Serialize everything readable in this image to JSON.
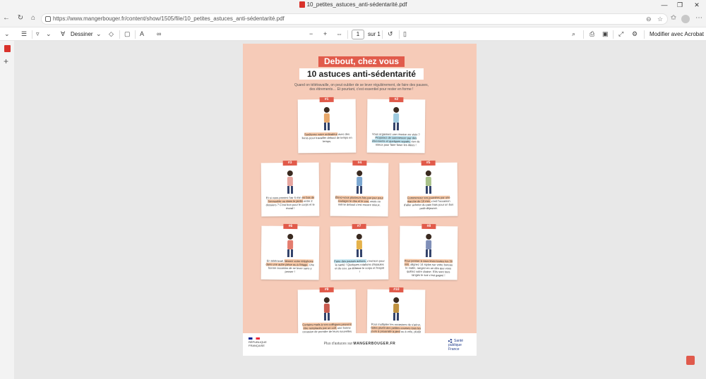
{
  "window": {
    "title": "10_petites_astuces_anti-sédentarité.pdf",
    "min": "—",
    "max": "❐",
    "close": "✕"
  },
  "address": {
    "url": "https://www.mangerbouger.fr/content/show/1505/file/10_petites_astuces_anti-sédentarité.pdf"
  },
  "pdf_toolbar": {
    "draw_label": "Dessiner",
    "page_current": "1",
    "page_total": "sur 1",
    "zoom_out": "−",
    "zoom_in": "+",
    "open_acrobat": "Modifier avec Acrobat"
  },
  "poster": {
    "title1": "Debout, chez vous",
    "title2": "10 astuces anti-sédentarité",
    "intro": "Quand on télétravaille, on peut oublier de se lever régulièrement, de faire des pauses, des étirements… Et pourtant, c'est essentiel pour rester en forme !",
    "cards": [
      {
        "num": "#1",
        "pre": "",
        "hl": "Surélevez votre ordinateur",
        "post": " avec des livres pour travailler debout de temps en temps."
      },
      {
        "num": "#2",
        "pre": "Vous organisez une réunion en visio ? ",
        "hl": "Proposez de commencer par des étirements et quelques squats,",
        "post": " rien de mieux pour faire fuser les idées !"
      },
      {
        "num": "#3",
        "pre": "Et si vous preniez l'air 5 min ",
        "hl": "en bas de l'immeuble ou dans le jardin",
        "post": " entre 2 dossiers ? C'est bon pour le corps et le moral !"
      },
      {
        "num": "#4",
        "pre": "",
        "hl": "Étirez-vous plusieurs fois par jour pour soulager le dos et le cou,",
        "post": " assis ou même debout c'est encore mieux."
      },
      {
        "num": "#5",
        "pre": "",
        "hl": "Commencez vos journées par une marche de 10 min,",
        "post": " c'est l'occasion d'aller acheter du pain frais pour un bon petit-déjeuner."
      },
      {
        "num": "#6",
        "pre": "En télétravail, ",
        "hl": "laissez votre téléphone dans une autre pièce ou à l'étage.",
        "post": " Une bonne occasion de se lever sans y penser !"
      },
      {
        "num": "#7",
        "pre": "",
        "hl": "Faire des pauses actives,",
        "post": " c'est bon pour la santé ! Quelques rotations d'épaules et du cou, ça délasse le corps et l'esprit !"
      },
      {
        "num": "#8",
        "pre": "",
        "hl": "Pour penser à vous lever toutes les 30 min,",
        "post": " alignez 14 stylos sur votre bureau le matin, rangez-en un dès que vous quittez votre chaise. S'ils sont tous rangés le soir c'est gagné !"
      },
      {
        "num": "#9",
        "pre": "",
        "hl": "Certains mails à vos collègues peuvent être remplacés par un coll,",
        "post": " une bonne occasion de prendre de leurs nouvelles et de marcher un peu en téléphonant !"
      },
      {
        "num": "#10",
        "pre": "Pour multiplier les occasions de s'aérer, ",
        "hl": "faites plutôt des petites courses tous les jours à proximité à pied",
        "post": " ou à vélo, plutôt qu'un gros plein le weekend !"
      }
    ],
    "footer_left": "RÉPUBLIQUE FRANÇAISE",
    "footer_mid_pre": "Plus d'astuces sur",
    "footer_mid_brand": "MANGERBOUGER.FR",
    "footer_right": "Santé publique France"
  }
}
